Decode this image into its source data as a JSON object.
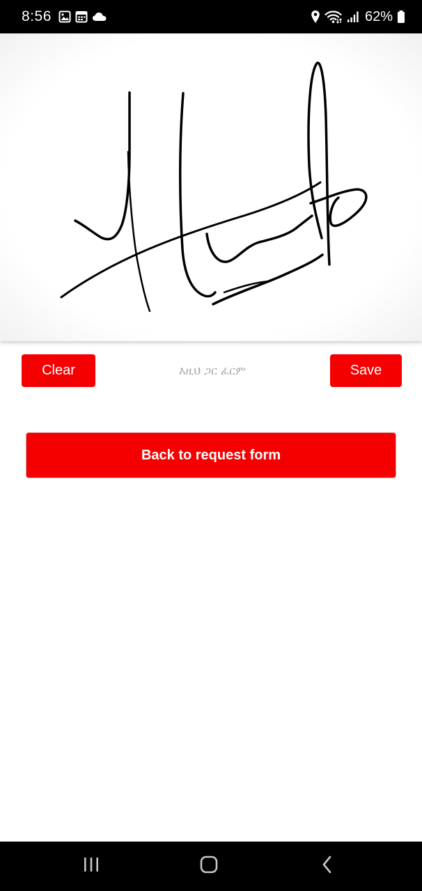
{
  "status_bar": {
    "time": "8:56",
    "battery_percent": "62%",
    "left_icons": [
      "image-icon",
      "calendar-icon",
      "cloud-icon"
    ],
    "right_icons": [
      "location-icon",
      "wifi-icon",
      "signal-icon",
      "battery-icon"
    ]
  },
  "signature_pad": {
    "stroke_color": "#000000",
    "has_signature": true
  },
  "controls": {
    "clear_label": "Clear",
    "sign_here_hint": "እዚህ ጋር ፈርም",
    "save_label": "Save"
  },
  "back_button": {
    "label": "Back to request form"
  },
  "nav_bar": {
    "buttons": [
      "recents-icon",
      "home-icon",
      "back-icon"
    ]
  },
  "colors": {
    "accent": "#f50000",
    "hint_text": "#a8a8a8",
    "system_bars": "#000000"
  }
}
